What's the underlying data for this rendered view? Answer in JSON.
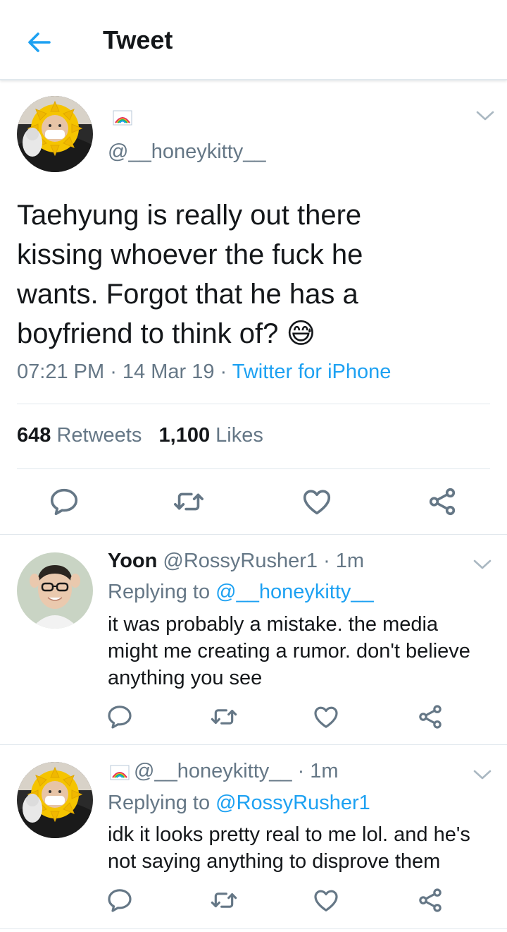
{
  "header": {
    "title": "Tweet",
    "back_icon": "arrow-left-icon"
  },
  "main_tweet": {
    "handle": "@__honeykitty__",
    "display_name_icon": "rainbow-flag-icon",
    "text_lines": [
      "Taehyung is really out there",
      "kissing whoever the fuck he",
      "wants. Forgot that he has a",
      "boyfriend to think of?"
    ],
    "emoji": "😅",
    "time": "07:21 PM",
    "sep1": " · ",
    "date": "14 Mar 19",
    "sep2": " · ",
    "source": "Twitter for iPhone",
    "retweets_count": "648",
    "retweets_label": "Retweets",
    "likes_count": "1,100",
    "likes_label": "Likes"
  },
  "replies": [
    {
      "name": "Yoon",
      "handle": "@RossyRusher1",
      "time": "· 1m",
      "replying_prefix": "Replying to",
      "replying_to": "@__honeykitty__",
      "text_lines": [
        "it was probably a mistake. the media",
        "might me creating a rumor. don't believe",
        "anything you see"
      ]
    },
    {
      "name_icon": "rainbow-flag-icon",
      "handle": "@__honeykitty__",
      "time": "· 1m",
      "replying_prefix": "Replying to",
      "replying_to": "@RossyRusher1",
      "text_lines": [
        "idk it looks pretty real to me lol. and he's",
        "not saying anything to disprove them"
      ]
    }
  ],
  "colors": {
    "accent": "#1da1f2",
    "text": "#14171a",
    "muted": "#657786",
    "divider": "#e1e8ed"
  }
}
